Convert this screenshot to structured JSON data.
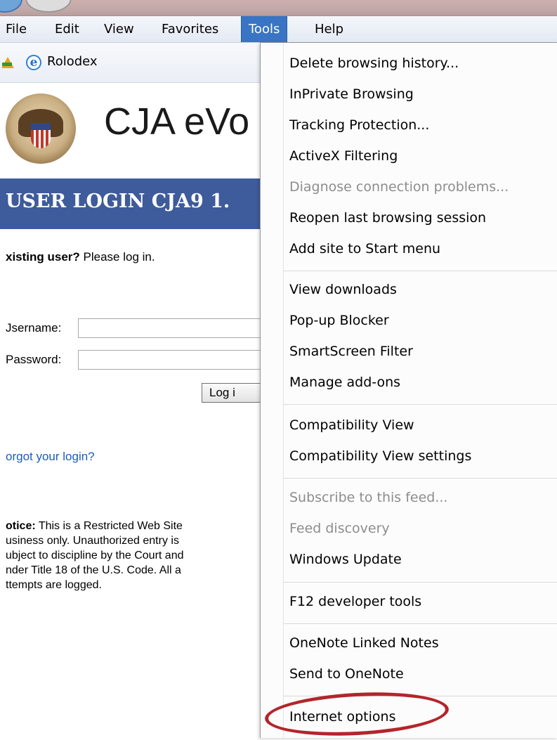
{
  "menubar": {
    "items": [
      {
        "label": "File"
      },
      {
        "label": "Edit"
      },
      {
        "label": "View"
      },
      {
        "label": "Favorites"
      },
      {
        "label": "Tools",
        "active": true
      },
      {
        "label": "Help"
      }
    ]
  },
  "favorites_bar": {
    "add_icon": "add-to-favorites-icon",
    "link_icon": "internet-explorer-icon",
    "link_label": "Rolodex"
  },
  "page": {
    "site_title": "CJA eVo",
    "login_banner": "USER LOGIN CJA9 1.",
    "existing_user_bold": "xisting user?",
    "existing_user_rest": " Please log in.",
    "username_label": "Jsername:",
    "password_label": "Password:",
    "login_button": "Log i",
    "forgot_link": "orgot your login?",
    "notice_bold": "otice:",
    "notice_lines": [
      " This is a Restricted Web Site",
      "usiness only. Unauthorized entry is",
      "ubject to discipline by the Court and",
      "nder Title 18 of the U.S. Code. All a",
      "ttempts are logged."
    ]
  },
  "tools_menu": {
    "items": [
      {
        "label": "Delete browsing history...",
        "enabled": true
      },
      {
        "label": "InPrivate Browsing",
        "enabled": true
      },
      {
        "label": "Tracking Protection...",
        "enabled": true
      },
      {
        "label": "ActiveX Filtering",
        "enabled": true
      },
      {
        "label": "Diagnose connection problems...",
        "enabled": false
      },
      {
        "label": "Reopen last browsing session",
        "enabled": true
      },
      {
        "label": "Add site to Start menu",
        "enabled": true
      },
      {
        "label": "View downloads",
        "enabled": true
      },
      {
        "label": "Pop-up Blocker",
        "enabled": true
      },
      {
        "label": "SmartScreen Filter",
        "enabled": true
      },
      {
        "label": "Manage add-ons",
        "enabled": true
      },
      {
        "label": "Compatibility View",
        "enabled": true
      },
      {
        "label": "Compatibility View settings",
        "enabled": true
      },
      {
        "label": "Subscribe to this feed...",
        "enabled": false
      },
      {
        "label": "Feed discovery",
        "enabled": false
      },
      {
        "label": "Windows Update",
        "enabled": true
      },
      {
        "label": "F12 developer tools",
        "enabled": true
      },
      {
        "label": "OneNote Linked Notes",
        "enabled": true
      },
      {
        "label": "Send to OneNote",
        "enabled": true
      },
      {
        "label": "Internet options",
        "enabled": true,
        "circled": true
      }
    ]
  },
  "colors": {
    "menu_active": "#3a74c4",
    "login_banner": "#3e5b9b",
    "link": "#1a5fb4",
    "disabled_text": "#8d8d8d",
    "highlight_ring": "#b3252b"
  }
}
